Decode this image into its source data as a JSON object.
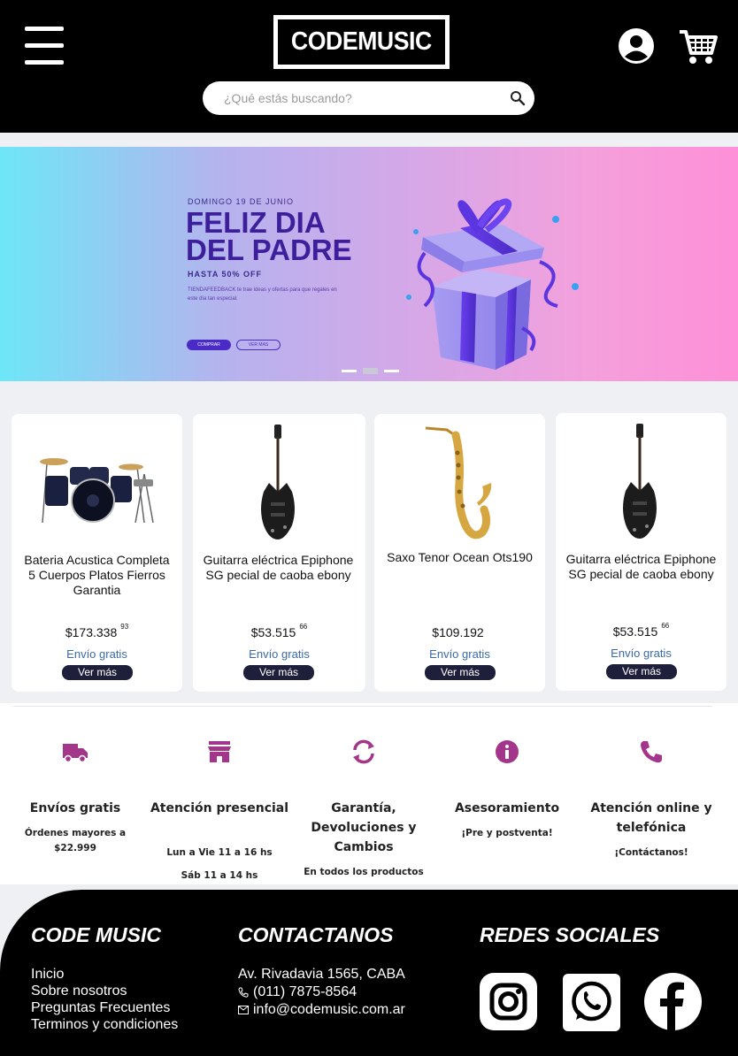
{
  "header": {
    "logo_text": "CODEMUSIC",
    "menu_icon": "hamburger-menu-icon",
    "user_icon": "user-account-icon",
    "cart_icon": "shopping-cart-icon",
    "search_placeholder": "¿Qué estás buscando?",
    "search_icon": "search-icon"
  },
  "banner": {
    "date": "DOMINGO 19 DE JUNIO",
    "title_line1": "FELIZ DIA",
    "title_line2": "DEL PADRE",
    "discount": "HASTA 50% OFF",
    "description": "TIENDAFEEDBACK te trae ideas y ofertas para que regales en este día tan especial.",
    "buy_label": "COMPRAR",
    "more_label": "VER MAS",
    "slide_count": 3,
    "active_slide": 2
  },
  "products": [
    {
      "name": "Bateria Acustica Completa 5 Cuerpos Platos Fierros Garantia",
      "price": "$173.338",
      "cents": "93",
      "shipping": "Envío gratis",
      "button": "Ver más",
      "image": "drum-kit-image"
    },
    {
      "name": "Guitarra eléctrica Epiphone SG pecial de caoba ebony",
      "price": "$53.515",
      "cents": "66",
      "shipping": "Envío gratis",
      "button": "Ver más",
      "image": "electric-guitar-image"
    },
    {
      "name": "Saxo Tenor Ocean Ots190",
      "price": "$109.192",
      "cents": "",
      "shipping": "Envío gratis",
      "button": "Ver más",
      "image": "saxophone-image"
    },
    {
      "name": "Guitarra eléctrica Epiphone SG pecial de caoba ebony",
      "price": "$53.515",
      "cents": "66",
      "shipping": "Envío gratis",
      "button": "Ver más",
      "image": "electric-guitar-image"
    }
  ],
  "features": [
    {
      "title": "Envíos gratis",
      "lines": [
        "Órdenes mayores a",
        "$22.999"
      ],
      "icon": "truck-icon"
    },
    {
      "title": "Atención presencial",
      "lines": [
        "Lun a Vie 11 a 16 hs",
        "Sáb 11 a 14 hs"
      ],
      "icon": "store-icon"
    },
    {
      "title": "Garantía, Devoluciones y Cambios",
      "lines": [
        "En todos los productos"
      ],
      "icon": "refresh-icon"
    },
    {
      "title": "Asesoramiento",
      "lines": [
        "¡Pre y postventa!"
      ],
      "icon": "info-icon"
    },
    {
      "title": "Atención online y telefónica",
      "lines": [
        "¡Contáctanos!"
      ],
      "icon": "phone-icon"
    }
  ],
  "accent_color": "#a3368a",
  "footer": {
    "brand": "CODE MUSIC",
    "links": [
      "Inicio",
      "Sobre nosotros",
      "Preguntas Frecuentes",
      "Terminos y condiciones"
    ],
    "contact_heading": "CONTACTANOS",
    "address": "Av. Rivadavia 1565, CABA",
    "phone": "(011) 7875-8564",
    "email": "info@codemusic.com.ar",
    "social_heading": "REDES SOCIALES",
    "social": [
      "instagram-icon",
      "whatsapp-icon",
      "facebook-icon"
    ]
  }
}
